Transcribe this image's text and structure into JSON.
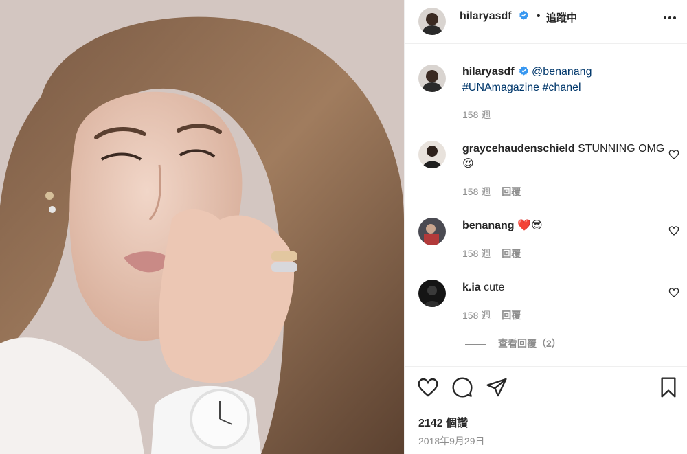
{
  "header": {
    "username": "hilaryasdf",
    "separator": "•",
    "follow_status": "追蹤中",
    "more_icon": "more-horizontal-icon"
  },
  "caption": {
    "username": "hilaryasdf",
    "mention": "@benanang",
    "hashtags": [
      "#UNAmagazine",
      "#chanel"
    ],
    "time": "158 週"
  },
  "comments": [
    {
      "username": "graycehaudenschield",
      "text": "STUNNING OMG😍",
      "time": "158 週",
      "reply_label": "回覆"
    },
    {
      "username": "benanang",
      "text": "❤️😎",
      "time": "158 週",
      "reply_label": "回覆"
    },
    {
      "username": "k.ia",
      "text": "cute",
      "time": "158 週",
      "reply_label": "回覆"
    }
  ],
  "view_replies": "查看回覆（2）",
  "actions": {
    "icons": [
      "heart-icon",
      "comment-icon",
      "share-icon",
      "bookmark-icon"
    ]
  },
  "likes": "2142 個讚",
  "date": "2018年9月29日",
  "colors": {
    "verified": "#3897f0",
    "link": "#00376b",
    "muted": "#8e8e8e",
    "text": "#262626"
  }
}
